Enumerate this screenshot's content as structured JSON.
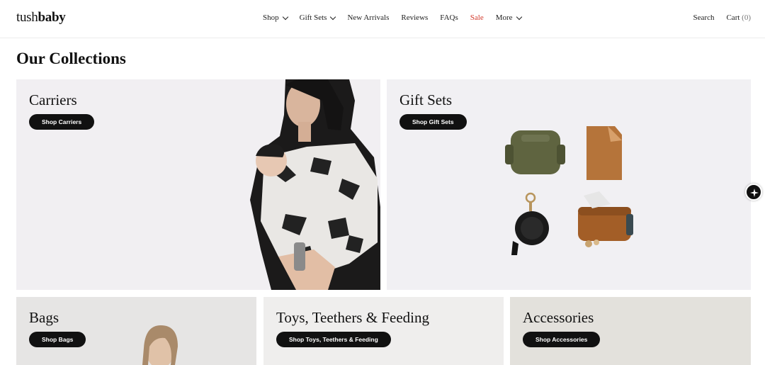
{
  "header": {
    "logo_light": "tush",
    "logo_bold": "baby",
    "nav": [
      {
        "label": "Shop",
        "has_dropdown": true
      },
      {
        "label": "Gift Sets",
        "has_dropdown": true
      },
      {
        "label": "New Arrivals",
        "has_dropdown": false
      },
      {
        "label": "Reviews",
        "has_dropdown": false
      },
      {
        "label": "FAQs",
        "has_dropdown": false
      },
      {
        "label": "Sale",
        "has_dropdown": false
      },
      {
        "label": "More",
        "has_dropdown": true
      }
    ],
    "search_label": "Search",
    "cart_label": "Cart",
    "cart_count": "(0)"
  },
  "main": {
    "title": "Our Collections",
    "collections": [
      {
        "title": "Carriers",
        "button": "Shop Carriers"
      },
      {
        "title": "Gift Sets",
        "button": "Shop Gift Sets"
      },
      {
        "title": "Bags",
        "button": "Shop Bags"
      },
      {
        "title": "Toys, Teethers & Feeding",
        "button": "Shop Toys, Teethers & Feeding"
      },
      {
        "title": "Accessories",
        "button": "Shop Accessories"
      }
    ]
  },
  "colors": {
    "sale": "#d33a2c",
    "button_bg": "#111111",
    "button_text": "#ffffff"
  },
  "icons": {
    "nav_dropdown": "chevron-down-icon",
    "floating_action": "sparkle-icon"
  }
}
